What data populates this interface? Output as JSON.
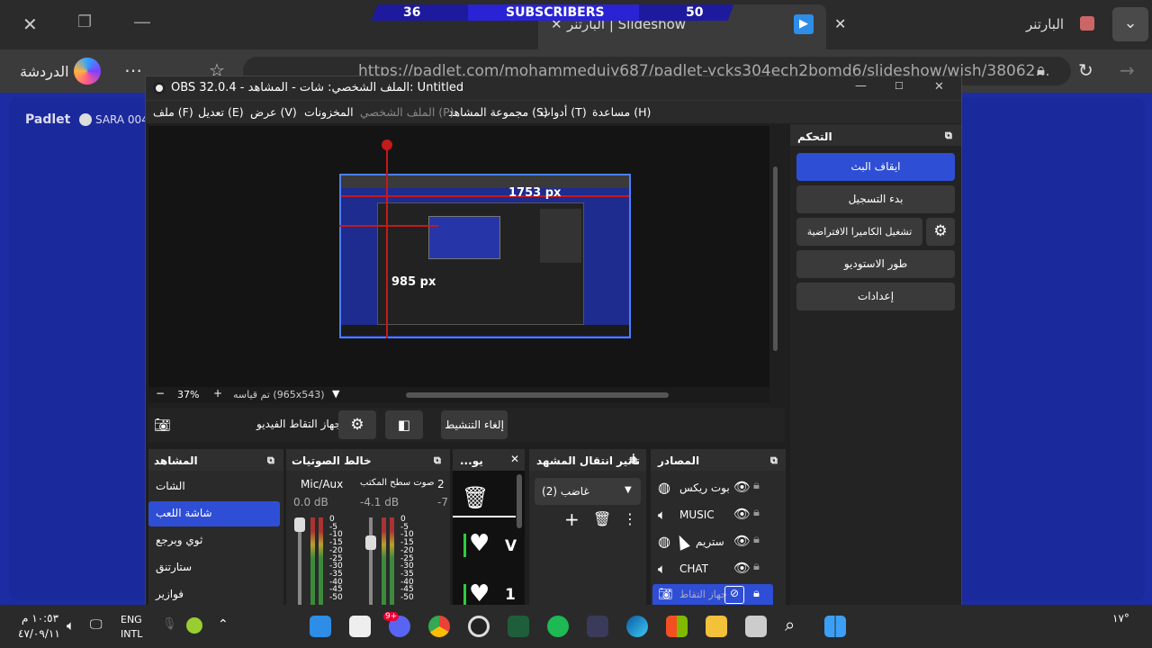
{
  "browser": {
    "tab_title": "البارتنر | Slideshow",
    "other_tab": "البارتنر",
    "chat_label": "الدردشة",
    "url": "https://padlet.com/mohammeduiy687/padlet-ycks304ech2bomd6/slideshow/wish/38062..."
  },
  "overlay": {
    "left": "36",
    "title": "SUBSCRIBERS",
    "right": "50"
  },
  "padlet": {
    "logo": "Padlet",
    "user": "SARA 004"
  },
  "obs": {
    "title": "OBS 32.0.4 - الملف الشخصي: شات - المشاهد: Untitled",
    "menu": [
      "مساعدة (H)",
      "أدوات (T)",
      "مجموعة المشاهد (S)",
      "الملف الشخصي (P)",
      "المخزونات",
      "عرض (V)",
      "تعديل (E)",
      "ملف (F)"
    ],
    "preview_measure_h": "1753 px",
    "preview_measure_v": "985 px",
    "zoom": "37%",
    "canvas_info": "تم قياسه (965x543)",
    "source_toolbar": {
      "deactivate": "إلغاء التنشيط",
      "source_name": "جهاز التقاط الفيديو"
    },
    "controls": {
      "title": "التحكم",
      "stop_stream": "ايقاف البث",
      "start_record": "بدء التسجيل",
      "virtual_cam": "تشغيل الكاميرا الافتراضية",
      "studio_mode": "طور الاستوديو",
      "settings": "إعدادات"
    },
    "scenes": {
      "title": "المشاهد",
      "items": [
        "الشات",
        "شاشة اللعب",
        "ثوي وبرجع",
        "ستارتنق",
        "فوازير"
      ],
      "selected": "شاشة اللعب"
    },
    "mixer": {
      "title": "خالط الصوتيات",
      "channels": [
        {
          "name": "Mic/Aux",
          "db": "0.0 dB"
        },
        {
          "name": "صوت سطح المكتب",
          "db": "-4.1 dB"
        },
        {
          "name": "2",
          "db": "-7"
        }
      ],
      "scale": [
        "0",
        "-5",
        "-10",
        "-15",
        "-20",
        "-25",
        "-30",
        "-35",
        "-40",
        "-45",
        "-50"
      ]
    },
    "chat_dock": {
      "title": "...يو",
      "rows": [
        "V",
        "1"
      ]
    },
    "transitions": {
      "title": "تأثير انتقال المشهد",
      "value": "غاضب (2)"
    },
    "sources": {
      "title": "المصادر",
      "items": [
        {
          "name": "بوت ريكس",
          "icon": "globe-icon"
        },
        {
          "name": "MUSIC",
          "icon": "speaker-icon"
        },
        {
          "name": "ستريم",
          "icon": "globe-icon"
        },
        {
          "name": "CHAT",
          "icon": "speaker-icon"
        },
        {
          "name": "جهاز التقاط",
          "icon": "camera-icon"
        }
      ]
    }
  },
  "taskbar": {
    "time": "١٠:٥٣ م",
    "date": "٤٧/٠٩/١١",
    "lang": "ENG",
    "lang2": "INTL",
    "temp": "١٧°",
    "discord_badge": "9+"
  }
}
